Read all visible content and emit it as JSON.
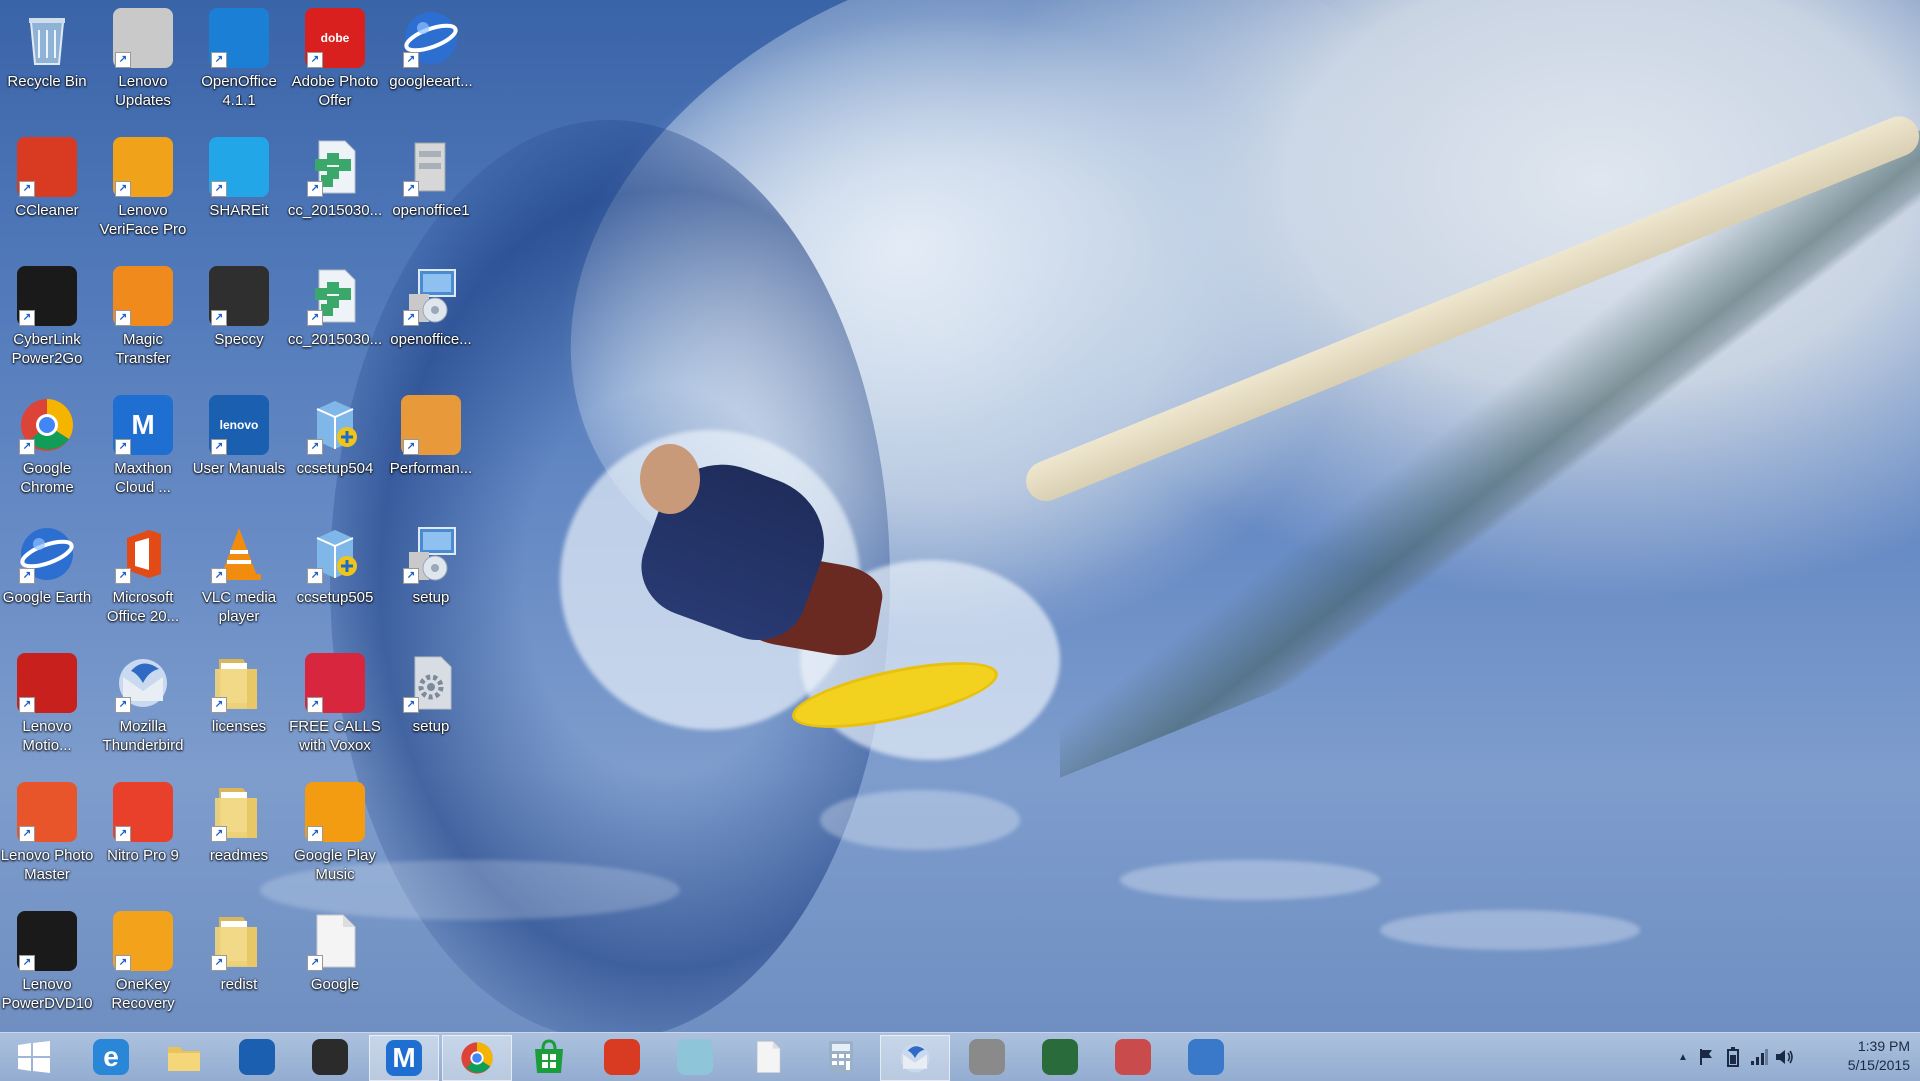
{
  "desktop": {
    "icons": [
      {
        "label": "Recycle Bin",
        "icon": "recycle-bin-icon",
        "color": "#8fb3d6"
      },
      {
        "label": "Lenovo Updates",
        "icon": "lenovo-updates-icon",
        "color": "#c9c9c9"
      },
      {
        "label": "OpenOffice 4.1.1",
        "icon": "openoffice-icon",
        "color": "#1c7fd6"
      },
      {
        "label": "Adobe Photo Offer",
        "icon": "adobe-icon",
        "color": "#d9201e",
        "glyph_text": "dobe"
      },
      {
        "label": "googleeart...",
        "icon": "google-earth-icon",
        "color": "#2d6fd1"
      },
      {
        "label": "CCleaner",
        "icon": "ccleaner-icon",
        "color": "#d83a22"
      },
      {
        "label": "Lenovo VeriFace Pro",
        "icon": "veriface-icon",
        "color": "#f0a21a"
      },
      {
        "label": "SHAREit",
        "icon": "shareit-icon",
        "color": "#23a6e8"
      },
      {
        "label": "cc_2015030...",
        "icon": "registry-file-icon",
        "color": "#3aa86a"
      },
      {
        "label": "openoffice1",
        "icon": "cabinet-file-icon",
        "color": "#d7d7d7"
      },
      {
        "label": "CyberLink Power2Go",
        "icon": "power2go-icon",
        "color": "#1a1a1a"
      },
      {
        "label": "Magic Transfer",
        "icon": "magic-transfer-icon",
        "color": "#f08a1c"
      },
      {
        "label": "Speccy",
        "icon": "speccy-icon",
        "color": "#2f2f2f"
      },
      {
        "label": "cc_2015030...",
        "icon": "registry-file-icon",
        "color": "#3aa86a"
      },
      {
        "label": "openoffice...",
        "icon": "setup-installer-icon",
        "color": "#4a8ad1"
      },
      {
        "label": "Google Chrome",
        "icon": "chrome-icon",
        "color": "#db4437"
      },
      {
        "label": "Maxthon Cloud ...",
        "icon": "maxthon-icon",
        "color": "#1e6fd1",
        "glyph_text": "M"
      },
      {
        "label": "User Manuals",
        "icon": "lenovo-monitor-icon",
        "color": "#1a5fb0",
        "glyph_text": "lenovo"
      },
      {
        "label": "ccsetup504",
        "icon": "installer-package-icon",
        "color": "#7fb8e8"
      },
      {
        "label": "Performan...",
        "icon": "performance-installer-icon",
        "color": "#e89a3a"
      },
      {
        "label": "Google Earth",
        "icon": "google-earth-icon",
        "color": "#2d6fd1"
      },
      {
        "label": "Microsoft Office 20...",
        "icon": "office-icon",
        "color": "#e34b16"
      },
      {
        "label": "VLC media player",
        "icon": "vlc-icon",
        "color": "#f28c0f"
      },
      {
        "label": "ccsetup505",
        "icon": "installer-package-icon",
        "color": "#7fb8e8"
      },
      {
        "label": "setup",
        "icon": "setup-installer-icon",
        "color": "#4a8ad1"
      },
      {
        "label": "Lenovo Motio...",
        "icon": "lenovo-motion-icon",
        "color": "#c8201c"
      },
      {
        "label": "Mozilla Thunderbird",
        "icon": "thunderbird-icon",
        "color": "#2f6bc4"
      },
      {
        "label": "licenses",
        "icon": "folder-icon",
        "color": "#f1d57a"
      },
      {
        "label": "FREE CALLS with Voxox",
        "icon": "voxox-icon",
        "color": "#d7263d"
      },
      {
        "label": "setup",
        "icon": "gear-document-icon",
        "color": "#d8dde3"
      },
      {
        "label": "Lenovo Photo Master",
        "icon": "photo-master-icon",
        "color": "#e8552a"
      },
      {
        "label": "Nitro Pro 9",
        "icon": "nitro-icon",
        "color": "#e8402a"
      },
      {
        "label": "readmes",
        "icon": "folder-icon",
        "color": "#f1d57a"
      },
      {
        "label": "Google Play Music",
        "icon": "play-music-icon",
        "color": "#f39c12"
      },
      {
        "label": "Lenovo PowerDVD10",
        "icon": "powerdvd-icon",
        "color": "#1a1a1a"
      },
      {
        "label": "OneKey Recovery",
        "icon": "onekey-recovery-icon",
        "color": "#f3a21c"
      },
      {
        "label": "redist",
        "icon": "folder-icon",
        "color": "#f1d57a"
      },
      {
        "label": "Google",
        "icon": "blank-document-icon",
        "color": "#f4f4f4"
      }
    ]
  },
  "taskbar": {
    "items": [
      {
        "icon": "windows-start-icon",
        "color": "#ffffff",
        "active": false
      },
      {
        "icon": "internet-explorer-icon",
        "color": "#2a87d8",
        "glyph_text": "e",
        "active": false
      },
      {
        "icon": "file-explorer-icon",
        "color": "#e8c35a",
        "active": false
      },
      {
        "icon": "lenovo-monitor-icon",
        "color": "#1a5fb0",
        "active": false
      },
      {
        "icon": "razer-icon",
        "color": "#2b2b2b",
        "active": false
      },
      {
        "icon": "maxthon-icon",
        "color": "#1e6fd1",
        "glyph_text": "M",
        "active": true
      },
      {
        "icon": "chrome-icon",
        "color": "#db4437",
        "active": true
      },
      {
        "icon": "windows-store-icon",
        "color": "#1b9e3a",
        "active": false
      },
      {
        "icon": "ccleaner-icon",
        "color": "#d83a22",
        "active": false
      },
      {
        "icon": "glass-app-icon",
        "color": "#8ec5d8",
        "active": false
      },
      {
        "icon": "blank-document-icon",
        "color": "#f4f4f4",
        "active": false
      },
      {
        "icon": "calculator-icon",
        "color": "#9ab0c8",
        "active": false
      },
      {
        "icon": "thunderbird-icon",
        "color": "#2f6bc4",
        "active": true
      },
      {
        "icon": "firewall-icon",
        "color": "#8a8a8a",
        "active": false
      },
      {
        "icon": "solitaire-icon",
        "color": "#2a6b3c",
        "active": false
      },
      {
        "icon": "snipping-tool-icon",
        "color": "#c94b4b",
        "active": false
      },
      {
        "icon": "remote-desktop-icon",
        "color": "#3a79c9",
        "active": false
      }
    ],
    "tray": {
      "show_hidden": "▲",
      "flag_icon": "action-center-flag-icon",
      "battery_icon": "battery-icon",
      "network_icon": "wifi-signal-icon",
      "volume_icon": "speaker-icon"
    },
    "clock": {
      "time": "1:39 PM",
      "date": "5/15/2015"
    }
  }
}
